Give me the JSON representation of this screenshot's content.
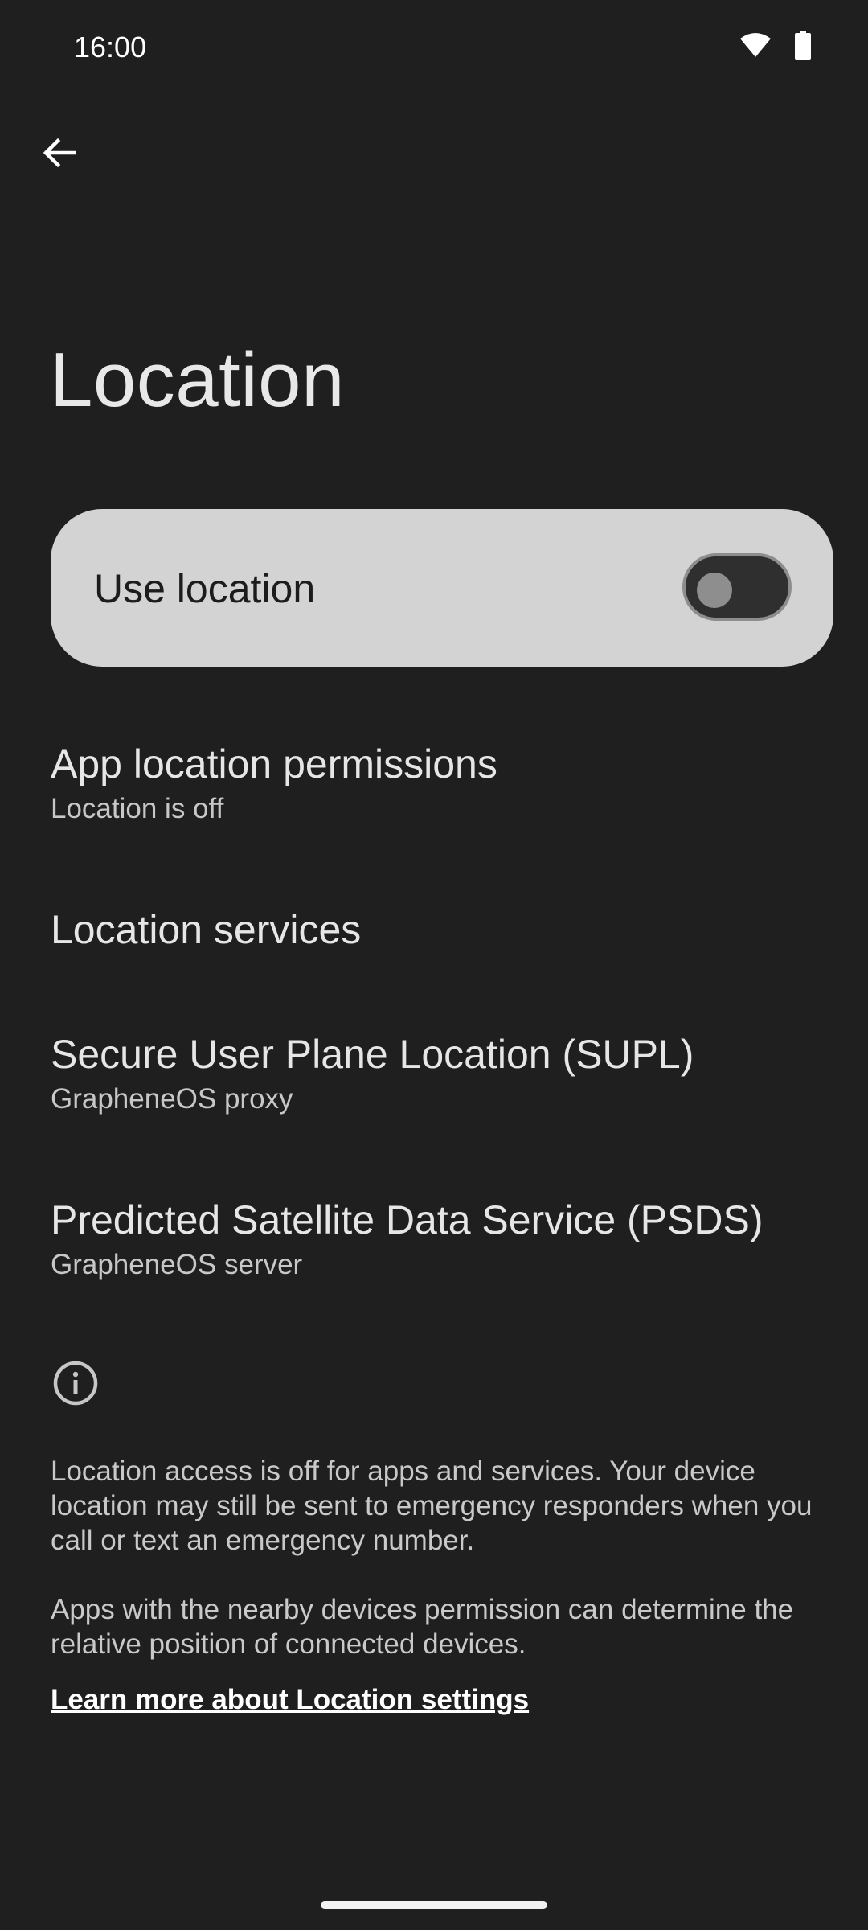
{
  "status_bar": {
    "time": "16:00"
  },
  "header": {
    "title": "Location"
  },
  "main_switch": {
    "label": "Use location",
    "checked": false
  },
  "preferences": [
    {
      "title": "App location permissions",
      "summary": "Location is off"
    },
    {
      "title": "Location services",
      "summary": ""
    },
    {
      "title": "Secure User Plane Location (SUPL)",
      "summary": "GrapheneOS proxy"
    },
    {
      "title": "Predicted Satellite Data Service (PSDS)",
      "summary": "GrapheneOS server"
    }
  ],
  "footer": {
    "paragraph_1": "Location access is off for apps and services. Your device location may still be sent to emergency responders when you call or text an emergency number.",
    "paragraph_2": "Apps with the nearby devices permission can determine the relative position of connected devices.",
    "learn_more": "Learn more about Location settings"
  },
  "icons": {
    "back": "arrow-back-icon",
    "wifi": "wifi-icon",
    "battery": "battery-icon",
    "info": "info-icon"
  },
  "colors": {
    "background": "#1f1f1f",
    "switch_card": "#d3d3d3"
  }
}
